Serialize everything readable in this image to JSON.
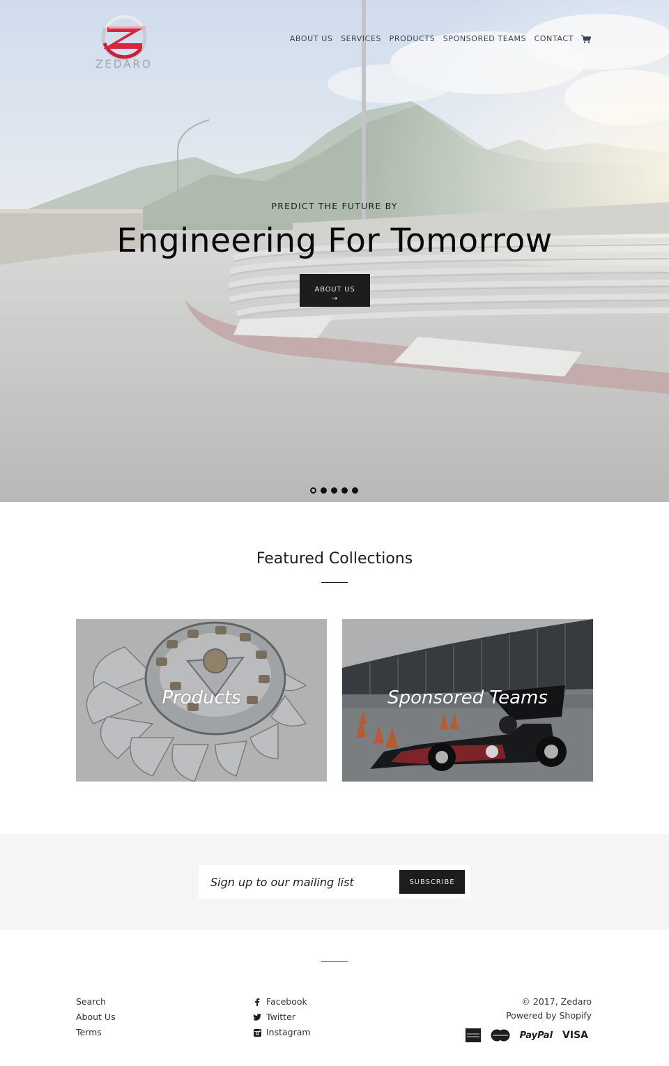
{
  "brand": {
    "name": "Zedaro",
    "wordmark": "ZEDARO",
    "colors": {
      "accent_red": "#d7263d",
      "dark": "#1c1d1d",
      "silver": "#a8adb3"
    }
  },
  "nav": {
    "items": [
      {
        "label": "ABOUT US"
      },
      {
        "label": "SERVICES"
      },
      {
        "label": "PRODUCTS"
      },
      {
        "label": "SPONSORED TEAMS"
      },
      {
        "label": "CONTACT"
      }
    ],
    "cart_icon": "cart-icon"
  },
  "hero": {
    "subtitle": "PREDICT THE FUTURE BY",
    "title": "Engineering For Tomorrow",
    "button_label": "ABOUT US",
    "button_arrow": "→",
    "slides_total": 5,
    "active_slide": 1
  },
  "featured": {
    "title": "Featured Collections",
    "collections": [
      {
        "label": "Products"
      },
      {
        "label": "Sponsored Teams"
      }
    ]
  },
  "newsletter": {
    "placeholder": "Sign up to our mailing list",
    "value": "",
    "button_label": "SUBSCRIBE"
  },
  "footer": {
    "links": [
      {
        "label": "Search"
      },
      {
        "label": "About Us"
      },
      {
        "label": "Terms"
      }
    ],
    "social": [
      {
        "label": "Facebook",
        "icon": "facebook-icon"
      },
      {
        "label": "Twitter",
        "icon": "twitter-icon"
      },
      {
        "label": "Instagram",
        "icon": "instagram-icon"
      }
    ],
    "copyright": "© 2017, Zedaro",
    "powered_by": "Powered by Shopify",
    "payment_methods": [
      {
        "name": "American Express",
        "icon": "amex-icon"
      },
      {
        "name": "MasterCard",
        "icon": "mastercard-icon"
      },
      {
        "name": "PayPal",
        "label": "PayPal",
        "icon": "paypal-icon"
      },
      {
        "name": "Visa",
        "label": "VISA",
        "icon": "visa-icon"
      }
    ]
  }
}
